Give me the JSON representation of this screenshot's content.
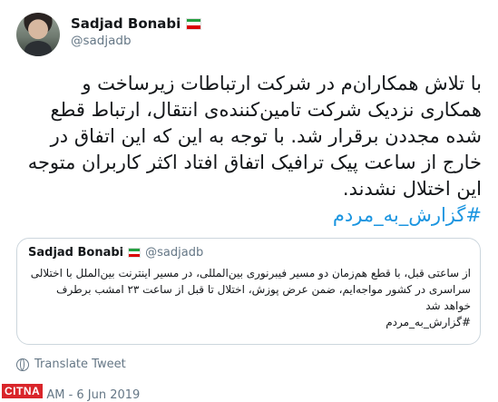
{
  "tweet": {
    "author": {
      "display_name": "Sadjad Bonabi",
      "handle": "@sadjadb"
    },
    "text": "با تلاش همکاران‌م در شرکت ارتباطات زیرساخت و همکاری نزدیک شرکت تامین‌کننده‌ی انتقال، ارتباط قطع شده مجددن برقرار شد. با توجه به این که این اتفاق در خارج از ساعت پیک ترافیک اتفاق افتاد اکثر کاربران متوجه این اختلال نشدند.",
    "hashtag": "#گزارش_به_مردم",
    "quoted": {
      "display_name": "Sadjad Bonabi",
      "handle": "@sadjadb",
      "text": "از ساعتی قبل، با قطع هم‌زمان دو مسیر فیبرنوری بین‌المللی، در مسیر اینترنت بین‌الملل با اختلالی سراسری در کشور مواجه‌ایم، ضمن عرض پوزش، اختلال تا قبل از ساعت ۲۳ امشب برطرف خواهد شد",
      "hashtag": "#گزارش_به_مردم"
    },
    "translate_label": "Translate Tweet",
    "timestamp": "9:58 AM - 6 Jun 2019"
  },
  "watermark": "CITNA",
  "colors": {
    "link": "#1b95e0",
    "muted": "#657786",
    "border": "#ccd6dd"
  },
  "icons": {
    "flag": "iran-flag-icon",
    "translate": "globe-icon"
  }
}
